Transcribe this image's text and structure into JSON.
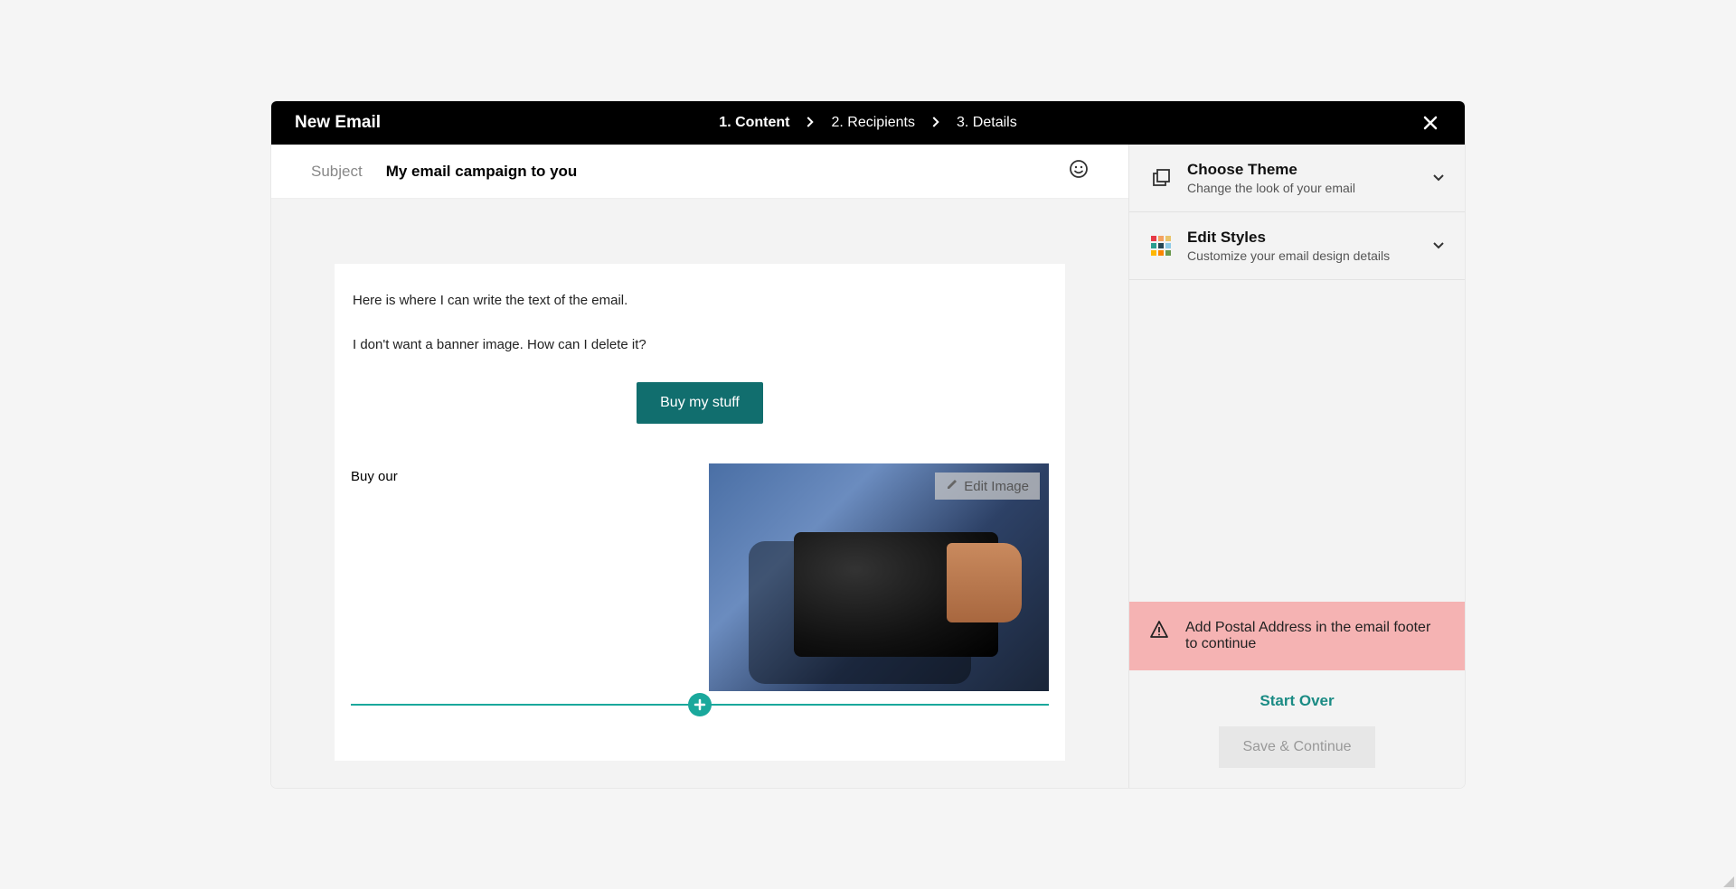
{
  "header": {
    "title": "New Email",
    "steps": [
      {
        "label": "1. Content",
        "active": true
      },
      {
        "label": "2. Recipients",
        "active": false
      },
      {
        "label": "3. Details",
        "active": false
      }
    ]
  },
  "subject": {
    "label": "Subject",
    "value": "My email campaign to you"
  },
  "email": {
    "paragraph1": "Here is where I can write the text of the email.",
    "paragraph2": "I don't want a banner image. How can I delete it?",
    "cta_label": "Buy my stuff",
    "two_col_text": "Buy our",
    "edit_image_label": "Edit Image"
  },
  "sidebar": {
    "theme": {
      "title": "Choose Theme",
      "subtitle": "Change the look of your email"
    },
    "styles": {
      "title": "Edit Styles",
      "subtitle": "Customize your email design details"
    },
    "warning": "Add Postal Address in the email footer to continue",
    "start_over": "Start Over",
    "save": "Save & Continue"
  }
}
